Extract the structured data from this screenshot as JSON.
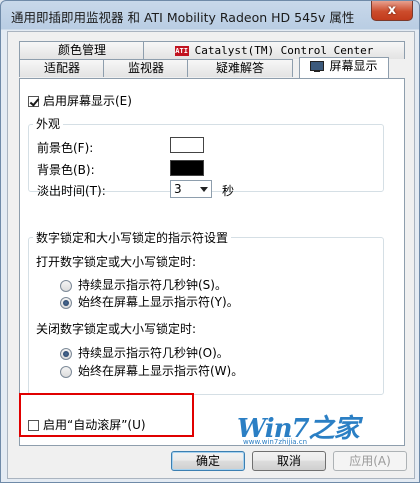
{
  "window": {
    "title": "通用即插即用监视器 和 ATI Mobility Radeon HD 545v 属性",
    "close_glyph": "x"
  },
  "tabs_row1": [
    {
      "label": "颜色管理"
    },
    {
      "logo": "ATI",
      "label": "Catalyst(TM) Control Center"
    }
  ],
  "tabs_row2": [
    {
      "label": "适配器"
    },
    {
      "label": "监视器"
    },
    {
      "label": "疑难解答"
    },
    {
      "label": "屏幕显示",
      "icon": "monitor-icon",
      "active": true
    }
  ],
  "panel": {
    "enable_osd": {
      "label": "启用屏幕显示(E)",
      "checked": true
    },
    "appearance": {
      "title": "外观",
      "foreground_label": "前景色(F):",
      "foreground_color": "#ffffff",
      "background_label": "背景色(B):",
      "background_color": "#000000",
      "fade_label": "淡出时间(T):",
      "fade_value": "3",
      "fade_unit": "秒"
    },
    "lock_indicators": {
      "title": "数字锁定和大小写锁定的指示符设置",
      "on_title": "打开数字锁定或大小写锁定时:",
      "on_options": [
        {
          "label": "持续显示指示符几秒钟(S)。",
          "selected": false
        },
        {
          "label": "始终在屏幕上显示指示符(Y)。",
          "selected": true
        }
      ],
      "off_title": "关闭数字锁定或大小写锁定时:",
      "off_options": [
        {
          "label": "持续显示指示符几秒钟(O)。",
          "selected": true
        },
        {
          "label": "始终在屏幕上显示指示符(W)。",
          "selected": false
        }
      ]
    },
    "auto_scroll": {
      "label": "启用“自动滚屏”(U)",
      "checked": false
    }
  },
  "buttons": {
    "ok": "确定",
    "cancel": "取消",
    "apply": "应用(A)"
  },
  "watermark": {
    "main": "Win7之家",
    "sub": "www.win7zhijia.cn"
  },
  "colors": {
    "highlight_box": "#e00000",
    "watermark": "#2b7fc4"
  }
}
